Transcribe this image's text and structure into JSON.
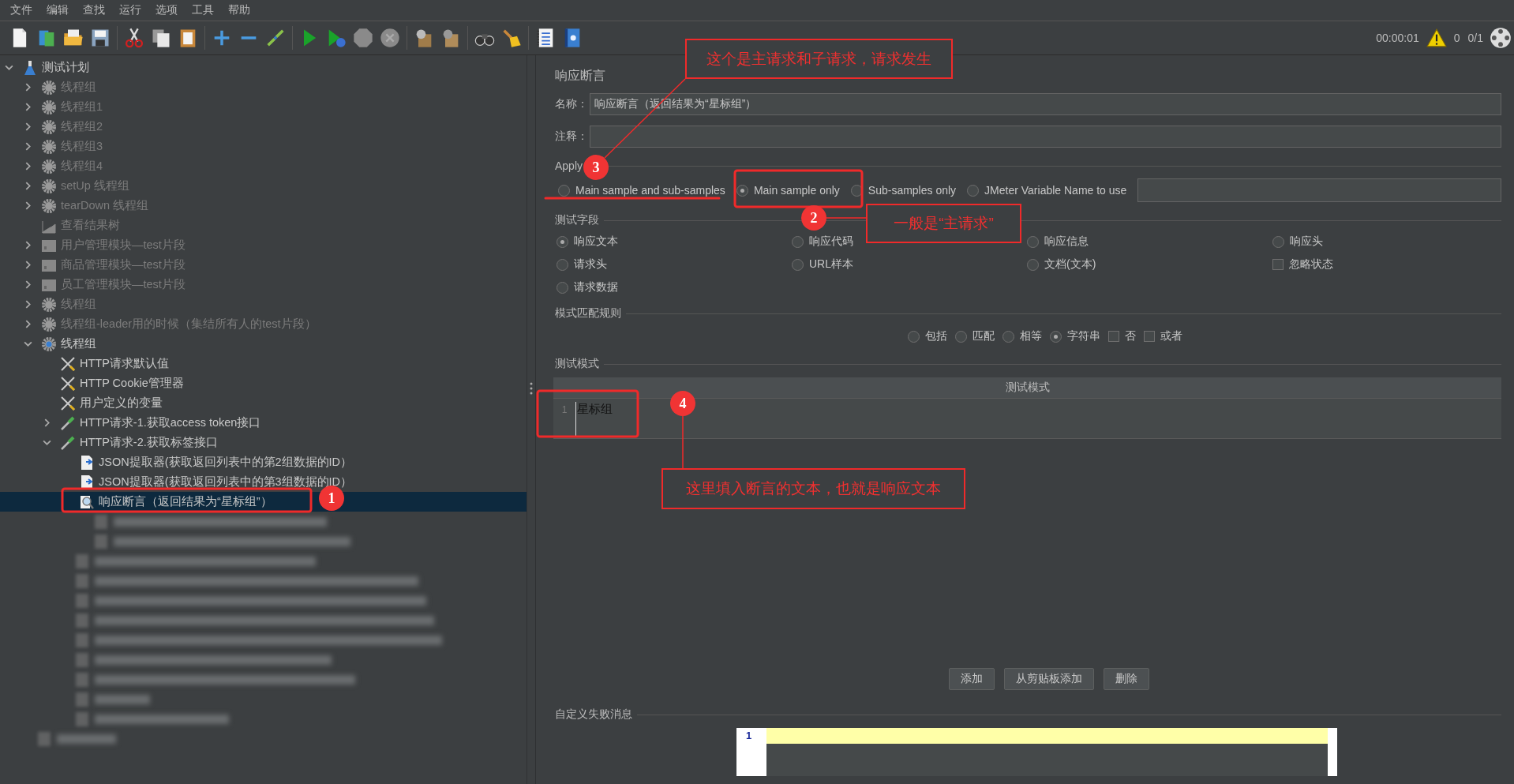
{
  "menu": [
    "文件",
    "编辑",
    "查找",
    "运行",
    "选项",
    "工具",
    "帮助"
  ],
  "status": {
    "elapsed": "00:00:01",
    "warnings": "0",
    "threads": "0/1"
  },
  "tree": [
    {
      "label": "测试计划",
      "kind": "plan",
      "expanded": true,
      "selected": false,
      "disabled": false,
      "children": [
        {
          "label": "线程组",
          "kind": "thread",
          "expanded": false,
          "selected": false,
          "disabled": true
        },
        {
          "label": "线程组1",
          "kind": "thread",
          "expanded": false,
          "selected": false,
          "disabled": true
        },
        {
          "label": "线程组2",
          "kind": "thread",
          "expanded": false,
          "selected": false,
          "disabled": true
        },
        {
          "label": "线程组3",
          "kind": "thread",
          "expanded": false,
          "selected": false,
          "disabled": true
        },
        {
          "label": "线程组4",
          "kind": "thread",
          "expanded": false,
          "selected": false,
          "disabled": true
        },
        {
          "label": "setUp 线程组",
          "kind": "thread",
          "expanded": false,
          "selected": false,
          "disabled": true
        },
        {
          "label": "tearDown 线程组",
          "kind": "thread",
          "expanded": false,
          "selected": false,
          "disabled": true
        },
        {
          "label": "查看结果树",
          "kind": "listener",
          "selected": false,
          "disabled": true
        },
        {
          "label": "用户管理模块—test片段",
          "kind": "fragment",
          "expanded": false,
          "selected": false,
          "disabled": true
        },
        {
          "label": "商品管理模块—test片段",
          "kind": "fragment",
          "expanded": false,
          "selected": false,
          "disabled": true
        },
        {
          "label": "员工管理模块—test片段",
          "kind": "fragment",
          "expanded": false,
          "selected": false,
          "disabled": true
        },
        {
          "label": "线程组",
          "kind": "thread",
          "expanded": false,
          "selected": false,
          "disabled": true
        },
        {
          "label": "线程组-leader用的时候（集结所有人的test片段）",
          "kind": "thread",
          "expanded": false,
          "selected": false,
          "disabled": true
        },
        {
          "label": "线程组",
          "kind": "thread",
          "expanded": true,
          "selected": false,
          "disabled": false,
          "children": [
            {
              "label": "HTTP请求默认值",
              "kind": "config",
              "selected": false,
              "disabled": false
            },
            {
              "label": "HTTP Cookie管理器",
              "kind": "config",
              "selected": false,
              "disabled": false
            },
            {
              "label": "用户定义的变量",
              "kind": "config",
              "selected": false,
              "disabled": false
            },
            {
              "label": "HTTP请求-1.获取access token接口",
              "kind": "sampler",
              "expanded": false,
              "selected": false,
              "disabled": false
            },
            {
              "label": "HTTP请求-2.获取标签接口",
              "kind": "sampler",
              "expanded": true,
              "selected": false,
              "disabled": false,
              "children": [
                {
                  "label": "JSON提取器(获取返回列表中的第2组数据的ID）",
                  "kind": "extractor",
                  "selected": false,
                  "disabled": false
                },
                {
                  "label": "JSON提取器(获取返回列表中的第3组数据的ID）",
                  "kind": "extractor",
                  "selected": false,
                  "disabled": false
                },
                {
                  "label": "响应断言（返回结果为“星标组”）",
                  "kind": "assertion",
                  "selected": true,
                  "disabled": false
                }
              ]
            }
          ]
        }
      ]
    }
  ],
  "editor": {
    "title": "响应断言",
    "name_label": "名称：",
    "name_value": "响应断言（返回结果为“星标组”）",
    "comment_label": "注释：",
    "apply": {
      "legend": "Apply",
      "options": [
        {
          "label": "Main sample and sub-samples",
          "selected": false
        },
        {
          "label": "Main sample only",
          "selected": true
        },
        {
          "label": "Sub-samples only",
          "selected": false
        },
        {
          "label": "JMeter Variable Name to use",
          "selected": false
        }
      ]
    },
    "test_field": {
      "legend": "测试字段",
      "options": [
        {
          "label": "响应文本",
          "kind": "radio",
          "selected": true
        },
        {
          "label": "响应代码",
          "kind": "radio",
          "selected": false
        },
        {
          "label": "响应信息",
          "kind": "radio",
          "selected": false
        },
        {
          "label": "响应头",
          "kind": "radio",
          "selected": false
        },
        {
          "label": "请求头",
          "kind": "radio",
          "selected": false
        },
        {
          "label": "URL样本",
          "kind": "radio",
          "selected": false
        },
        {
          "label": "文档(文本)",
          "kind": "radio",
          "selected": false
        },
        {
          "label": "忽略状态",
          "kind": "checkbox",
          "checked": false
        },
        {
          "label": "请求数据",
          "kind": "radio",
          "selected": false
        }
      ]
    },
    "pattern_rules": {
      "legend": "模式匹配规则",
      "options": [
        {
          "label": "包括",
          "kind": "radio",
          "selected": false
        },
        {
          "label": "匹配",
          "kind": "radio",
          "selected": false
        },
        {
          "label": "相等",
          "kind": "radio",
          "selected": false
        },
        {
          "label": "字符串",
          "kind": "radio",
          "selected": true
        },
        {
          "label": "否",
          "kind": "checkbox",
          "checked": false
        },
        {
          "label": "或者",
          "kind": "checkbox",
          "checked": false
        }
      ]
    },
    "patterns": {
      "legend": "测试模式",
      "column": "测试模式",
      "rows": [
        {
          "line": "1",
          "text": "星标组"
        }
      ]
    },
    "buttons": [
      "添加",
      "从剪贴板添加",
      "删除"
    ],
    "failure": {
      "legend": "自定义失败消息",
      "line": "1"
    }
  },
  "annotations": [
    {
      "number": "1"
    },
    {
      "number": "2",
      "note": "一般是“主请求”"
    },
    {
      "number": "3",
      "note": "这个是主请求和子请求，请求发生"
    },
    {
      "number": "4",
      "note": "这里填入断言的文本，也就是响应文本"
    }
  ]
}
